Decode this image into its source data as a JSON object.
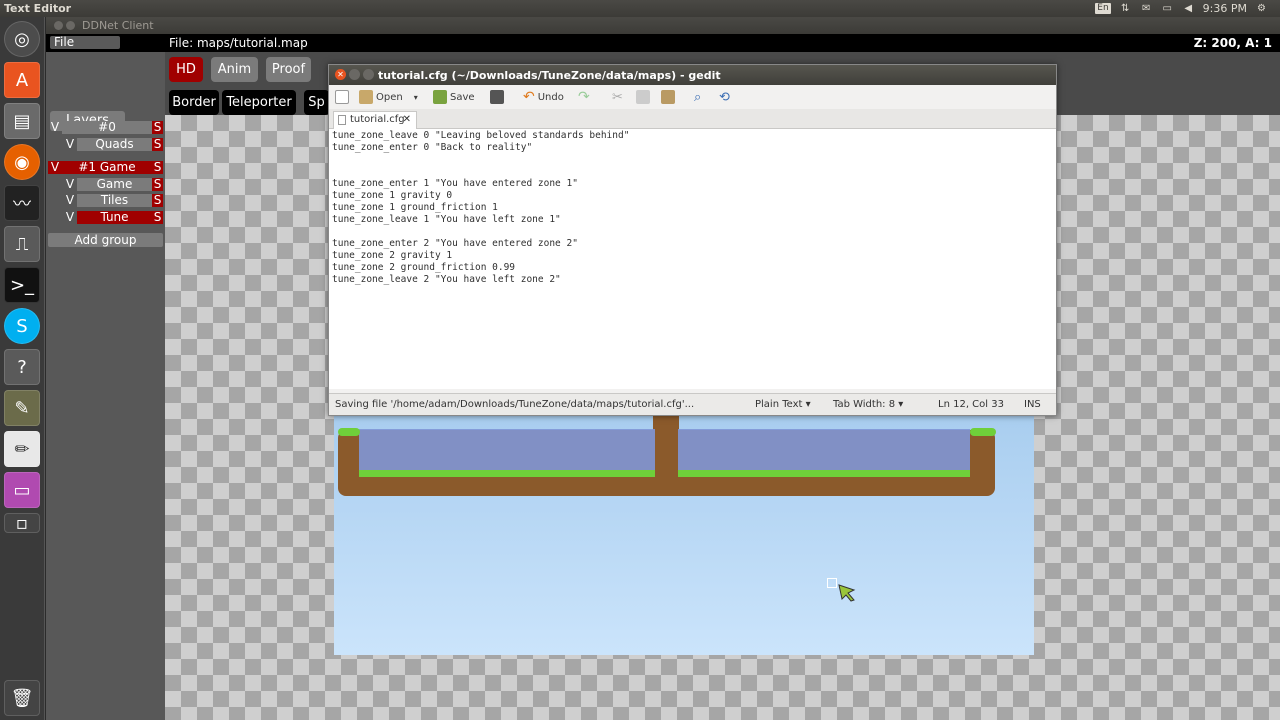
{
  "top_panel": {
    "app_title": "Text Editor",
    "lang": "En",
    "time": "9:36 PM"
  },
  "ddnet": {
    "window_title": "DDNet Client",
    "menu_file": "File",
    "file_label": "File: maps/tutorial.map",
    "zoom_info": "Z: 200, A: 1",
    "toolbar": {
      "hd": "HD",
      "anim": "Anim",
      "proof": "Proof",
      "border": "Border",
      "teleporter": "Teleporter",
      "sp": "Sp"
    },
    "layers_title": "Layers",
    "layers": [
      {
        "v": "V",
        "name": "#0",
        "s": "S"
      },
      {
        "v": "V",
        "name": "Quads",
        "s": "S"
      },
      {
        "v": "V",
        "name": "#1 Game",
        "s": "S"
      },
      {
        "v": "V",
        "name": "Game",
        "s": "S"
      },
      {
        "v": "V",
        "name": "Tiles",
        "s": "S"
      },
      {
        "v": "V",
        "name": "Tune",
        "s": "S"
      }
    ],
    "add_group": "Add group"
  },
  "gedit": {
    "window_title": "tutorial.cfg (~/Downloads/TuneZone/data/maps) - gedit",
    "toolbar": {
      "open": "Open",
      "save": "Save",
      "undo": "Undo"
    },
    "tab_label": "tutorial.cfg",
    "lines": [
      "tune_zone_leave 0 \"Leaving beloved standards behind\"",
      "tune_zone_enter 0 \"Back to reality\"",
      "",
      "",
      "tune_zone_enter 1 \"You have entered zone 1\"",
      "tune_zone 1 gravity 0",
      "tune_zone 1 ground_friction 1",
      "tune_zone_leave 1 \"You have left zone 1\"",
      "",
      "tune_zone_enter 2 \"You have entered zone 2\"",
      "tune_zone 2 gravity 1",
      "tune_zone 2 ground_friction 0.99",
      "tune_zone_leave 2 \"You have left zone 2\""
    ],
    "status": {
      "message": "Saving file '/home/adam/Downloads/TuneZone/data/maps/tutorial.cfg'...",
      "language": "Plain Text ▾",
      "tab_width": "Tab Width: 8 ▾",
      "position": "Ln 12, Col 33",
      "mode": "INS"
    }
  },
  "colors": {
    "layer_selected": "#a00000",
    "sky_top": "#a8cdef",
    "dirt": "#8b5a2b",
    "grass": "#6fcf3a"
  }
}
